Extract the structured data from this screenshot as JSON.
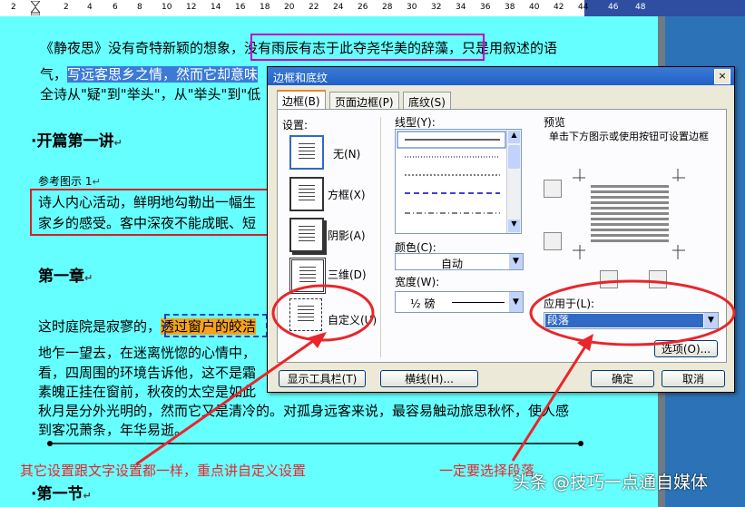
{
  "ruler": {
    "marks": [
      "2",
      "2",
      "4",
      "6",
      "8",
      "10",
      "12",
      "14",
      "16",
      "18",
      "20",
      "22",
      "24",
      "26",
      "28",
      "30",
      "32",
      "34",
      "36",
      "38",
      "40",
      "42",
      "44",
      "46",
      "48"
    ]
  },
  "doc": {
    "line1": "《静夜思》没有奇特新颖的想象，",
    "line1_boxed": "没有雨辰有志于此夺尧华美的辞藻",
    "line1_end": "，只是用叙述的语",
    "line2_start": "气，",
    "line2_sel": "写远客思乡之情，然而它却意味",
    "line3": "全诗从\"疑\"到\"举头\"，从\"举头\"到\"低",
    "heading1": "开篇第一讲",
    "caption": "参考图示 1",
    "box_line1": "诗人内心活动，鲜明地勾勒出一幅生",
    "box_line2": "家乡的感受。客中深夜不能成眠、短",
    "heading2": "第一章",
    "para2_start": "这时庭院是寂寥的，",
    "para2_hl": "透过窗户的皎洁",
    "l4": "地乍一望去，在迷离恍惚的心情中，",
    "l5": "看，四周围的环境告诉他，这不是霜",
    "l6": "素魄正挂在窗前，秋夜的太空是如此",
    "l7": "秋月是分外光明的，然而它又是清冷的。对孤身远客来说，最容易触动旅思秋怀，使人感",
    "l8": "到客况萧条，年华易逝。",
    "heading3": "第一节"
  },
  "dialog": {
    "title": "边框和底纹",
    "close": "×",
    "tabs": [
      "边框(B)",
      "页面边框(P)",
      "底纹(S)"
    ],
    "setting_label": "设置:",
    "settings": [
      "无(N)",
      "方框(X)",
      "阴影(A)",
      "三维(D)",
      "自定义(U)"
    ],
    "linestyle_label": "线型(Y):",
    "color_label": "颜色(C):",
    "color_value": "自动",
    "width_label": "宽度(W):",
    "width_value": "½ 磅",
    "preview_label": "预览",
    "preview_hint": "单击下方图示或使用按钮可设置边框",
    "apply_label": "应用于(L):",
    "apply_value": "段落",
    "options_button": "选项(O)...",
    "toolbar_button": "显示工具栏(T)",
    "hline_button": "横线(H)...",
    "ok_button": "确定",
    "cancel_button": "取消"
  },
  "annotations": {
    "left": "其它设置跟文字设置都一样，重点讲自定义设置",
    "right": "一定要选择段落"
  },
  "watermark": "头条 @技巧一点通自媒体",
  "colors": {
    "doc_bg": "#66ffff",
    "annotation_red": "#e8262b",
    "title_blue": "#2160c8"
  }
}
